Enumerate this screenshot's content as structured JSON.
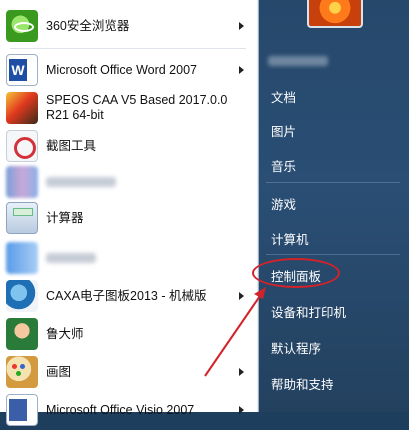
{
  "programs": [
    {
      "label": "360安全浏览器",
      "label2": "",
      "icon": "360-browser-icon",
      "has_arrow": true
    },
    {
      "label": "Microsoft Office Word 2007",
      "label2": "",
      "icon": "word-icon",
      "has_arrow": true
    },
    {
      "label": "SPEOS CAA V5 Based 2017.0.0",
      "label2": "R21 64-bit",
      "icon": "speos-icon",
      "has_arrow": false
    },
    {
      "label": "截图工具",
      "label2": "",
      "icon": "snipping-tool-icon",
      "has_arrow": false
    },
    {
      "label": "",
      "label2": "",
      "icon": "blurred-app-icon",
      "has_arrow": false
    },
    {
      "label": "计算器",
      "label2": "",
      "icon": "calculator-icon",
      "has_arrow": false
    },
    {
      "label": "",
      "label2": "",
      "icon": "blurred-app-icon",
      "has_arrow": false
    },
    {
      "label": "CAXA电子图板2013 - 机械版",
      "label2": "",
      "icon": "caxa-icon",
      "has_arrow": true
    },
    {
      "label": "鲁大师",
      "label2": "",
      "icon": "ludashi-icon",
      "has_arrow": false
    },
    {
      "label": "画图",
      "label2": "",
      "icon": "paint-icon",
      "has_arrow": true
    },
    {
      "label": "Microsoft Office Visio 2007",
      "label2": "",
      "icon": "visio-icon",
      "has_arrow": true
    }
  ],
  "right_links": [
    "文档",
    "图片",
    "音乐",
    "游戏",
    "计算机",
    "控制面板",
    "设备和打印机",
    "默认程序",
    "帮助和支持"
  ],
  "highlighted_item": "控制面板",
  "colors": {
    "highlight": "#d2222a",
    "right_pane": "#26486b"
  }
}
